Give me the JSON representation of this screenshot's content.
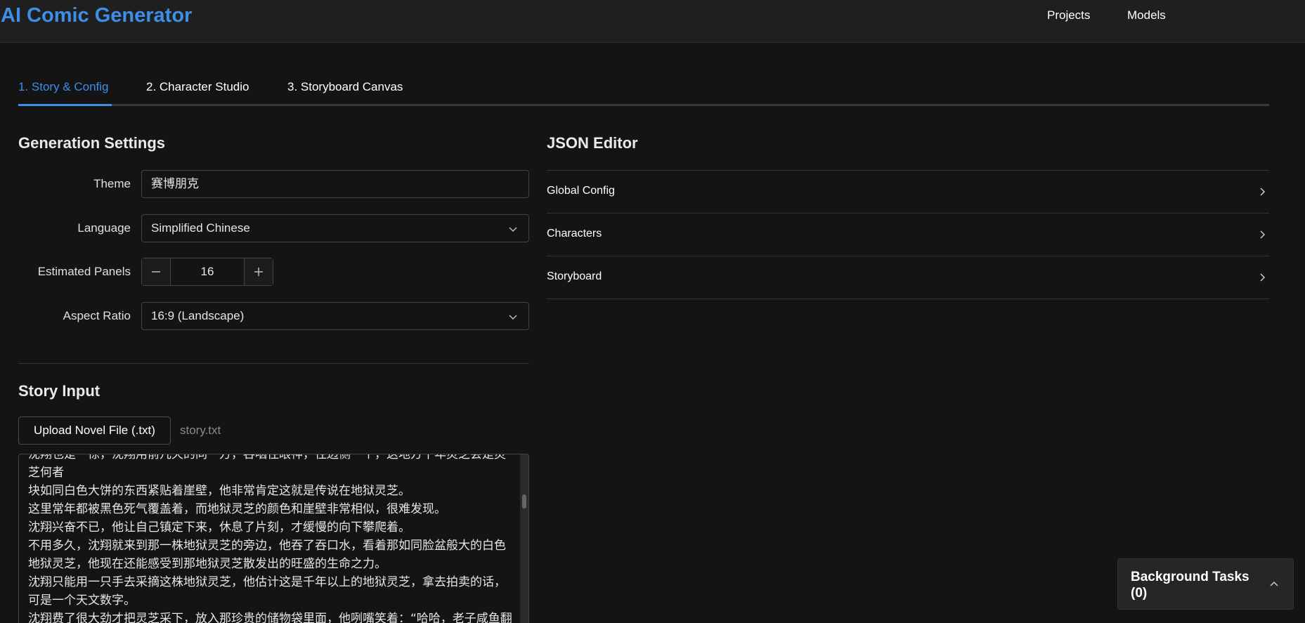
{
  "app": {
    "title": "AI Comic Generator"
  },
  "nav": {
    "projects": "Projects",
    "models": "Models"
  },
  "tabs": [
    {
      "label": "1. Story & Config",
      "active": true
    },
    {
      "label": "2. Character Studio",
      "active": false
    },
    {
      "label": "3. Storyboard Canvas",
      "active": false
    }
  ],
  "generation": {
    "title": "Generation Settings",
    "theme": {
      "label": "Theme",
      "value": "赛博朋克"
    },
    "language": {
      "label": "Language",
      "value": "Simplified Chinese"
    },
    "panels": {
      "label": "Estimated Panels",
      "value": "16"
    },
    "aspect": {
      "label": "Aspect Ratio",
      "value": "16:9 (Landscape)"
    }
  },
  "story": {
    "title": "Story Input",
    "upload_label": "Upload Novel File (.txt)",
    "file_name": "story.txt",
    "text": "沈翔也是一惊，沈翔用前几天的同一方，吞咽住眼神，往边侧一个，这地方千年灵芝会是灵芝何者\n块如同白色大饼的东西紧贴着崖壁，他非常肯定这就是传说在地狱灵芝。\n这里常年都被黑色死气覆盖着，而地狱灵芝的颜色和崖壁非常相似，很难发现。\n沈翔兴奋不已，他让自己镇定下来，休息了片刻，才缓慢的向下攀爬着。\n不用多久，沈翔就来到那一株地狱灵芝的旁边，他吞了吞口水，看着那如同脸盆般大的白色地狱灵芝，他现在还能感受到那地狱灵芝散发出的旺盛的生命之力。\n沈翔只能用一只手去采摘这株地狱灵芝，他估计这是千年以上的地狱灵芝，拿去拍卖的话，可是一个天文数字。\n沈翔费了很大劲才把灵芝采下，放入那珍贵的储物袋里面，他咧嘴笑着：“哈哈，老子咸鱼翻身的时候到了！”"
  },
  "json_editor": {
    "title": "JSON Editor",
    "sections": [
      "Global Config",
      "Characters",
      "Storyboard"
    ]
  },
  "background_tasks": {
    "label": "Background Tasks (0)"
  },
  "colors": {
    "accent": "#3d8ee8",
    "background": "#141414",
    "topbar": "#1f1f1f"
  }
}
